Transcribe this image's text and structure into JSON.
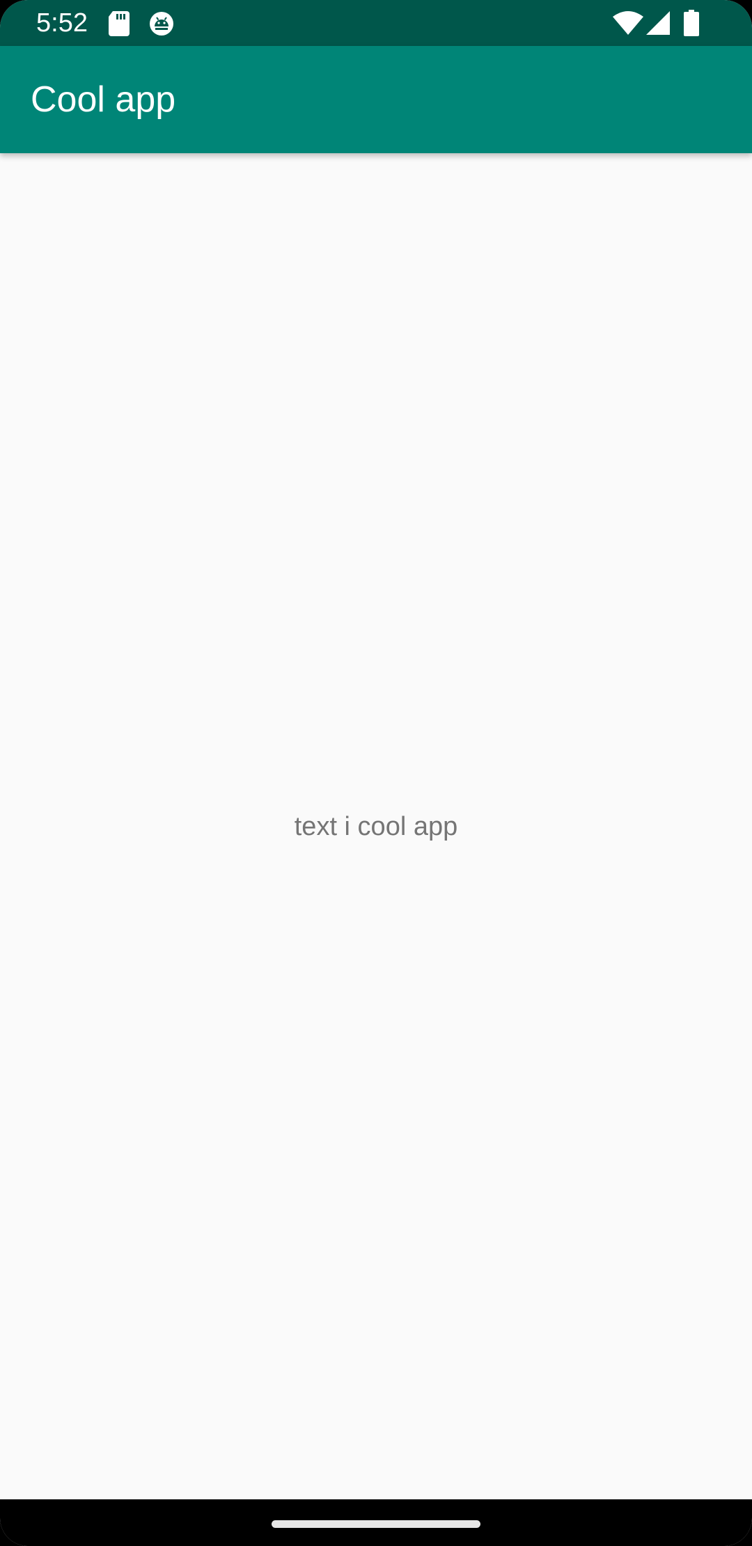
{
  "status_bar": {
    "time": "5:52",
    "icons_left": [
      "sd-card-icon",
      "android-debug-icon"
    ],
    "icons_right": [
      "wifi-icon",
      "cellular-signal-icon",
      "battery-icon"
    ],
    "color": "#00574b"
  },
  "app_bar": {
    "title": "Cool app",
    "color": "#008577"
  },
  "main": {
    "text": "text i cool app"
  },
  "nav_bar": {
    "handle": "home-gesture-handle"
  },
  "colors": {
    "background": "#fafafa",
    "body_text": "#757575"
  }
}
